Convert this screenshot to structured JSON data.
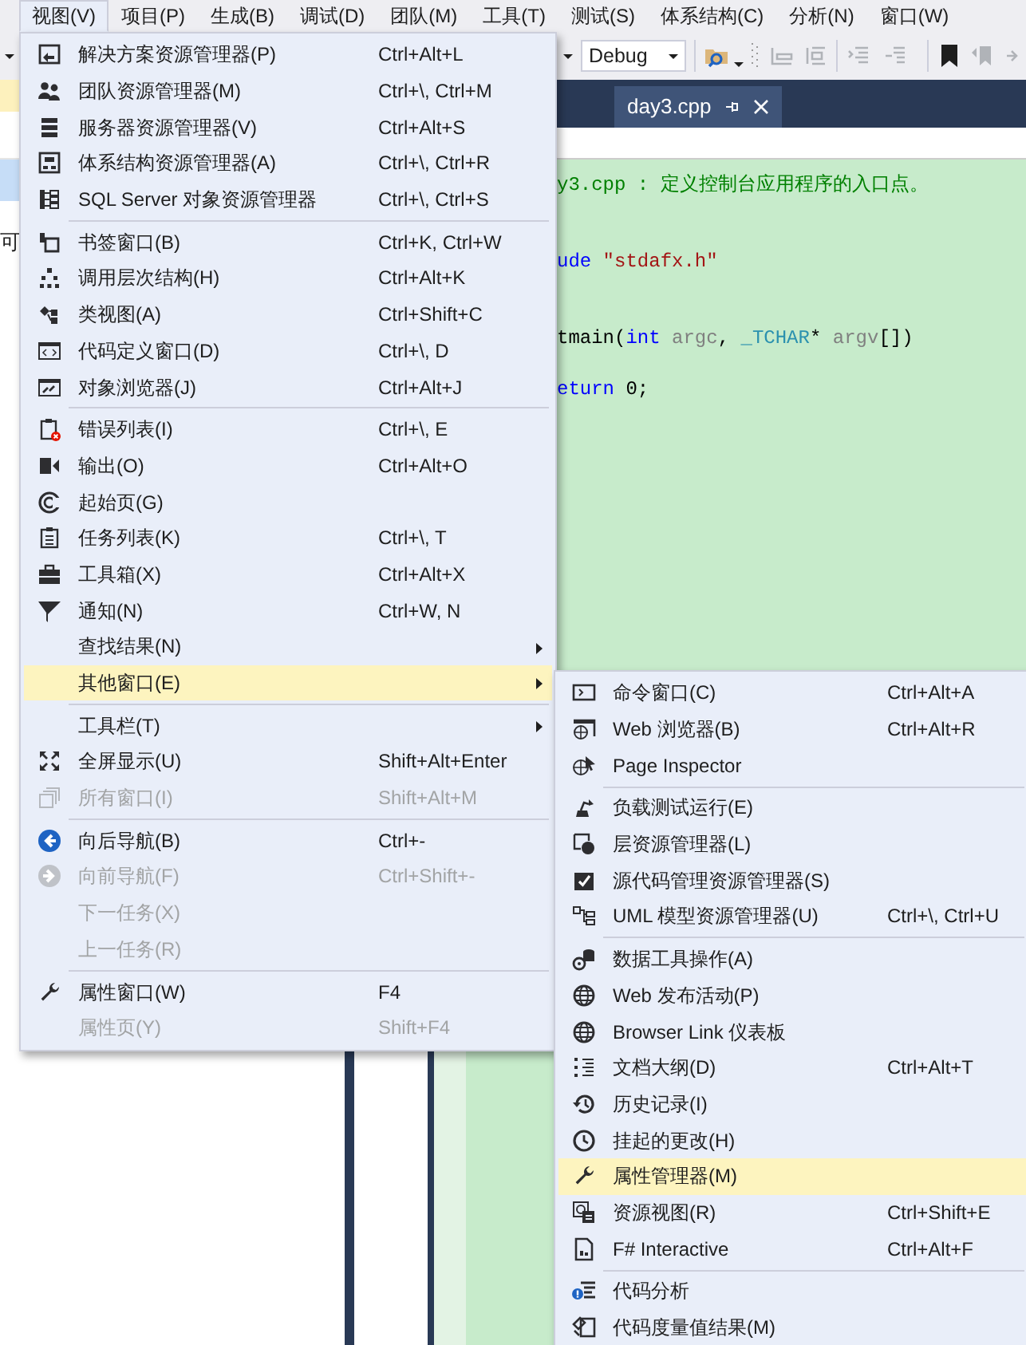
{
  "menu_bar": [
    {
      "label": "视图(V)",
      "selected": true
    },
    {
      "label": "项目(P)",
      "selected": false
    },
    {
      "label": "生成(B)",
      "selected": false
    },
    {
      "label": "调试(D)",
      "selected": false
    },
    {
      "label": "团队(M)",
      "selected": false
    },
    {
      "label": "工具(T)",
      "selected": false
    },
    {
      "label": "测试(S)",
      "selected": false
    },
    {
      "label": "体系结构(C)",
      "selected": false
    },
    {
      "label": "分析(N)",
      "selected": false
    },
    {
      "label": "窗口(W)",
      "selected": false
    }
  ],
  "toolbar": {
    "configuration": "Debug"
  },
  "side_panel": {
    "text": "可"
  },
  "editor_tab": {
    "label": "day3.cpp"
  },
  "code_lines": [
    {
      "tokens": [
        {
          "kind": "comment",
          "text": "y3.cpp : 定义控制台应用程序的入口点。"
        }
      ]
    },
    {
      "tokens": [
        {
          "kind": "keyword",
          "text": "ude"
        },
        {
          "kind": "string",
          "text": " \"stdafx.h\""
        }
      ]
    },
    {
      "tokens": [
        {
          "kind": "plain",
          "text": "tmain("
        },
        {
          "kind": "keyword",
          "text": "int"
        },
        {
          "kind": "param",
          "text": " argc"
        },
        {
          "kind": "plain",
          "text": ", "
        },
        {
          "kind": "type",
          "text": "_TCHAR"
        },
        {
          "kind": "plain",
          "text": "* "
        },
        {
          "kind": "param",
          "text": "argv"
        },
        {
          "kind": "plain",
          "text": "[])"
        }
      ]
    },
    {
      "tokens": [
        {
          "kind": "keyword",
          "text": "eturn"
        },
        {
          "kind": "plain",
          "text": " 0;"
        }
      ]
    }
  ],
  "view_menu": {
    "items": [
      {
        "kind": "item",
        "label": "解决方案资源管理器(P)",
        "shortcut": "Ctrl+Alt+L",
        "submenu": false,
        "disabled": false,
        "selected": false
      },
      {
        "kind": "item",
        "label": "团队资源管理器(M)",
        "shortcut": "Ctrl+\\, Ctrl+M",
        "submenu": false,
        "disabled": false,
        "selected": false
      },
      {
        "kind": "item",
        "label": "服务器资源管理器(V)",
        "shortcut": "Ctrl+Alt+S",
        "submenu": false,
        "disabled": false,
        "selected": false
      },
      {
        "kind": "item",
        "label": "体系结构资源管理器(A)",
        "shortcut": "Ctrl+\\, Ctrl+R",
        "submenu": false,
        "disabled": false,
        "selected": false
      },
      {
        "kind": "item",
        "label": "SQL Server 对象资源管理器",
        "shortcut": "Ctrl+\\, Ctrl+S",
        "submenu": false,
        "disabled": false,
        "selected": false
      },
      {
        "kind": "separator"
      },
      {
        "kind": "item",
        "label": "书签窗口(B)",
        "shortcut": "Ctrl+K, Ctrl+W",
        "submenu": false,
        "disabled": false,
        "selected": false
      },
      {
        "kind": "item",
        "label": "调用层次结构(H)",
        "shortcut": "Ctrl+Alt+K",
        "submenu": false,
        "disabled": false,
        "selected": false
      },
      {
        "kind": "item",
        "label": "类视图(A)",
        "shortcut": "Ctrl+Shift+C",
        "submenu": false,
        "disabled": false,
        "selected": false
      },
      {
        "kind": "item",
        "label": "代码定义窗口(D)",
        "shortcut": "Ctrl+\\, D",
        "submenu": false,
        "disabled": false,
        "selected": false
      },
      {
        "kind": "item",
        "label": "对象浏览器(J)",
        "shortcut": "Ctrl+Alt+J",
        "submenu": false,
        "disabled": false,
        "selected": false
      },
      {
        "kind": "separator"
      },
      {
        "kind": "item",
        "label": "错误列表(I)",
        "shortcut": "Ctrl+\\, E",
        "submenu": false,
        "disabled": false,
        "selected": false
      },
      {
        "kind": "item",
        "label": "输出(O)",
        "shortcut": "Ctrl+Alt+O",
        "submenu": false,
        "disabled": false,
        "selected": false
      },
      {
        "kind": "item",
        "label": "起始页(G)",
        "submenu": false,
        "disabled": false,
        "selected": false
      },
      {
        "kind": "item",
        "label": "任务列表(K)",
        "shortcut": "Ctrl+\\, T",
        "submenu": false,
        "disabled": false,
        "selected": false
      },
      {
        "kind": "item",
        "label": "工具箱(X)",
        "shortcut": "Ctrl+Alt+X",
        "submenu": false,
        "disabled": false,
        "selected": false
      },
      {
        "kind": "item",
        "label": "通知(N)",
        "shortcut": "Ctrl+W, N",
        "submenu": false,
        "disabled": false,
        "selected": false
      },
      {
        "kind": "item",
        "label": "查找结果(N)",
        "submenu": true,
        "disabled": false,
        "selected": false
      },
      {
        "kind": "item",
        "label": "其他窗口(E)",
        "submenu": true,
        "disabled": false,
        "selected": true
      },
      {
        "kind": "separator"
      },
      {
        "kind": "item",
        "label": "工具栏(T)",
        "submenu": true,
        "disabled": false,
        "selected": false
      },
      {
        "kind": "item",
        "label": "全屏显示(U)",
        "shortcut": "Shift+Alt+Enter",
        "submenu": false,
        "disabled": false,
        "selected": false
      },
      {
        "kind": "item",
        "label": "所有窗口(I)",
        "shortcut": "Shift+Alt+M",
        "submenu": false,
        "disabled": true,
        "selected": false
      },
      {
        "kind": "separator"
      },
      {
        "kind": "item",
        "label": "向后导航(B)",
        "shortcut": "Ctrl+-",
        "submenu": false,
        "disabled": false,
        "selected": false
      },
      {
        "kind": "item",
        "label": "向前导航(F)",
        "shortcut": "Ctrl+Shift+-",
        "submenu": false,
        "disabled": true,
        "selected": false
      },
      {
        "kind": "item",
        "label": "下一任务(X)",
        "submenu": false,
        "disabled": true,
        "selected": false
      },
      {
        "kind": "item",
        "label": "上一任务(R)",
        "submenu": false,
        "disabled": true,
        "selected": false
      },
      {
        "kind": "separator"
      },
      {
        "kind": "item",
        "label": "属性窗口(W)",
        "shortcut": "F4",
        "submenu": false,
        "disabled": false,
        "selected": false
      },
      {
        "kind": "item",
        "label": "属性页(Y)",
        "shortcut": "Shift+F4",
        "submenu": false,
        "disabled": true,
        "selected": false
      }
    ]
  },
  "other_windows_submenu": {
    "items": [
      {
        "kind": "item",
        "label": "命令窗口(C)",
        "shortcut": "Ctrl+Alt+A",
        "disabled": false,
        "selected": false
      },
      {
        "kind": "item",
        "label": "Web 浏览器(B)",
        "shortcut": "Ctrl+Alt+R",
        "disabled": false,
        "selected": false
      },
      {
        "kind": "item",
        "label": "Page Inspector",
        "disabled": false,
        "selected": false
      },
      {
        "kind": "separator"
      },
      {
        "kind": "item",
        "label": "负载测试运行(E)",
        "disabled": false,
        "selected": false
      },
      {
        "kind": "item",
        "label": "层资源管理器(L)",
        "disabled": false,
        "selected": false
      },
      {
        "kind": "item",
        "label": "源代码管理资源管理器(S)",
        "disabled": false,
        "selected": false
      },
      {
        "kind": "item",
        "label": "UML 模型资源管理器(U)",
        "shortcut": "Ctrl+\\, Ctrl+U",
        "disabled": false,
        "selected": false
      },
      {
        "kind": "separator"
      },
      {
        "kind": "item",
        "label": "数据工具操作(A)",
        "disabled": false,
        "selected": false
      },
      {
        "kind": "item",
        "label": "Web 发布活动(P)",
        "disabled": false,
        "selected": false
      },
      {
        "kind": "item",
        "label": "Browser Link 仪表板",
        "disabled": false,
        "selected": false
      },
      {
        "kind": "item",
        "label": "文档大纲(D)",
        "shortcut": "Ctrl+Alt+T",
        "disabled": false,
        "selected": false
      },
      {
        "kind": "item",
        "label": "历史记录(I)",
        "disabled": false,
        "selected": false
      },
      {
        "kind": "item",
        "label": "挂起的更改(H)",
        "disabled": false,
        "selected": false
      },
      {
        "kind": "item",
        "label": "属性管理器(M)",
        "disabled": false,
        "selected": true
      },
      {
        "kind": "item",
        "label": "资源视图(R)",
        "shortcut": "Ctrl+Shift+E",
        "disabled": false,
        "selected": false
      },
      {
        "kind": "item",
        "label": "F# Interactive",
        "shortcut": "Ctrl+Alt+F",
        "disabled": false,
        "selected": false
      },
      {
        "kind": "separator"
      },
      {
        "kind": "item",
        "label": "代码分析",
        "disabled": false,
        "selected": false
      },
      {
        "kind": "item",
        "label": "代码度量值结果(M)",
        "disabled": false,
        "selected": false
      }
    ]
  }
}
